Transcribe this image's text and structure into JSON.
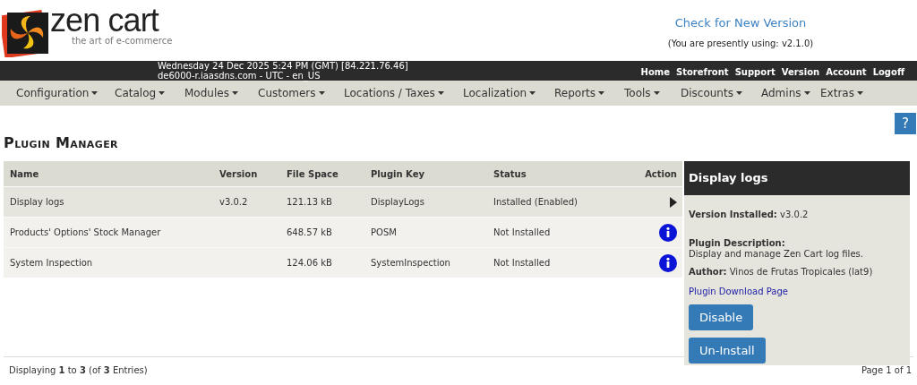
{
  "logo": {
    "name": "zen cart",
    "tagline": "the art of e-commerce"
  },
  "version_check": {
    "link": "Check for New Version",
    "current": "(You are presently using: v2.1.0)"
  },
  "top_bar": {
    "info": [
      "Wednesday 24 Dec 2025 5:24 PM (GMT) [84.221.76.46]",
      "de6000-r.iaasdns.com - UTC - en_US"
    ],
    "links": [
      "Home",
      "Storefront",
      "Support",
      "Version",
      "Account",
      "Logoff"
    ]
  },
  "menu": [
    "Configuration",
    "Catalog",
    "Modules",
    "Customers",
    "Locations / Taxes",
    "Localization",
    "Reports",
    "Tools",
    "Discounts",
    "Admins",
    "Extras"
  ],
  "help_button": "?",
  "page_title": "Plugin Manager",
  "table": {
    "columns": [
      "Name",
      "Version",
      "File Space",
      "Plugin Key",
      "Status",
      "Action"
    ],
    "rows": [
      {
        "name": "Display logs",
        "version": "v3.0.2",
        "file_space": "121.13 kB",
        "plugin_key": "DisplayLogs",
        "status": "Installed (Enabled)",
        "action": {
          "kind": "arrow"
        },
        "selected": true
      },
      {
        "name": "Products' Options' Stock Manager",
        "file_space": "648.57 kB",
        "plugin_key": "POSM",
        "status": "Not Installed",
        "action": {
          "kind": "info"
        },
        "selected": false
      },
      {
        "name": "System Inspection",
        "file_space": "124.06 kB",
        "plugin_key": "SystemInspection",
        "status": "Not Installed",
        "action": {
          "kind": "info"
        },
        "selected": false
      }
    ]
  },
  "details": {
    "title": "Display logs",
    "version_label": "Version Installed:",
    "version": "v3.0.2",
    "description_label": "Plugin Description:",
    "description": "Display and manage Zen Cart log files.",
    "author_label": "Author:",
    "author": "Vinos de Frutas Tropicales (lat9)",
    "link": "Plugin Download Page",
    "buttons": [
      "Disable",
      "Un-Install"
    ]
  },
  "footer": {
    "count": "Displaying **1** to **3** (of **3** Entries)",
    "page": "Page 1 of 1"
  }
}
